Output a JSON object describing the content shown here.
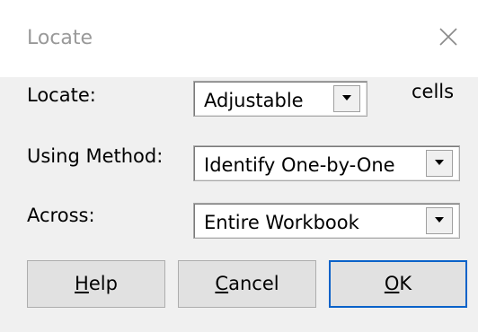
{
  "dialog": {
    "title": "Locate",
    "close_glyph": "close-icon"
  },
  "fields": {
    "locate": {
      "label": "Locate:",
      "value": "Adjustable",
      "suffix": "cells"
    },
    "method": {
      "label": "Using Method:",
      "value": "Identify One-by-One"
    },
    "across": {
      "label": "Across:",
      "value": "Entire Workbook"
    }
  },
  "buttons": {
    "help": {
      "mnemonic": "H",
      "rest": "elp"
    },
    "cancel": {
      "mnemonic": "C",
      "rest": "ancel"
    },
    "ok": {
      "mnemonic": "O",
      "rest": "K"
    }
  },
  "colors": {
    "accent": "#0a62c9",
    "title_text": "#999999"
  }
}
